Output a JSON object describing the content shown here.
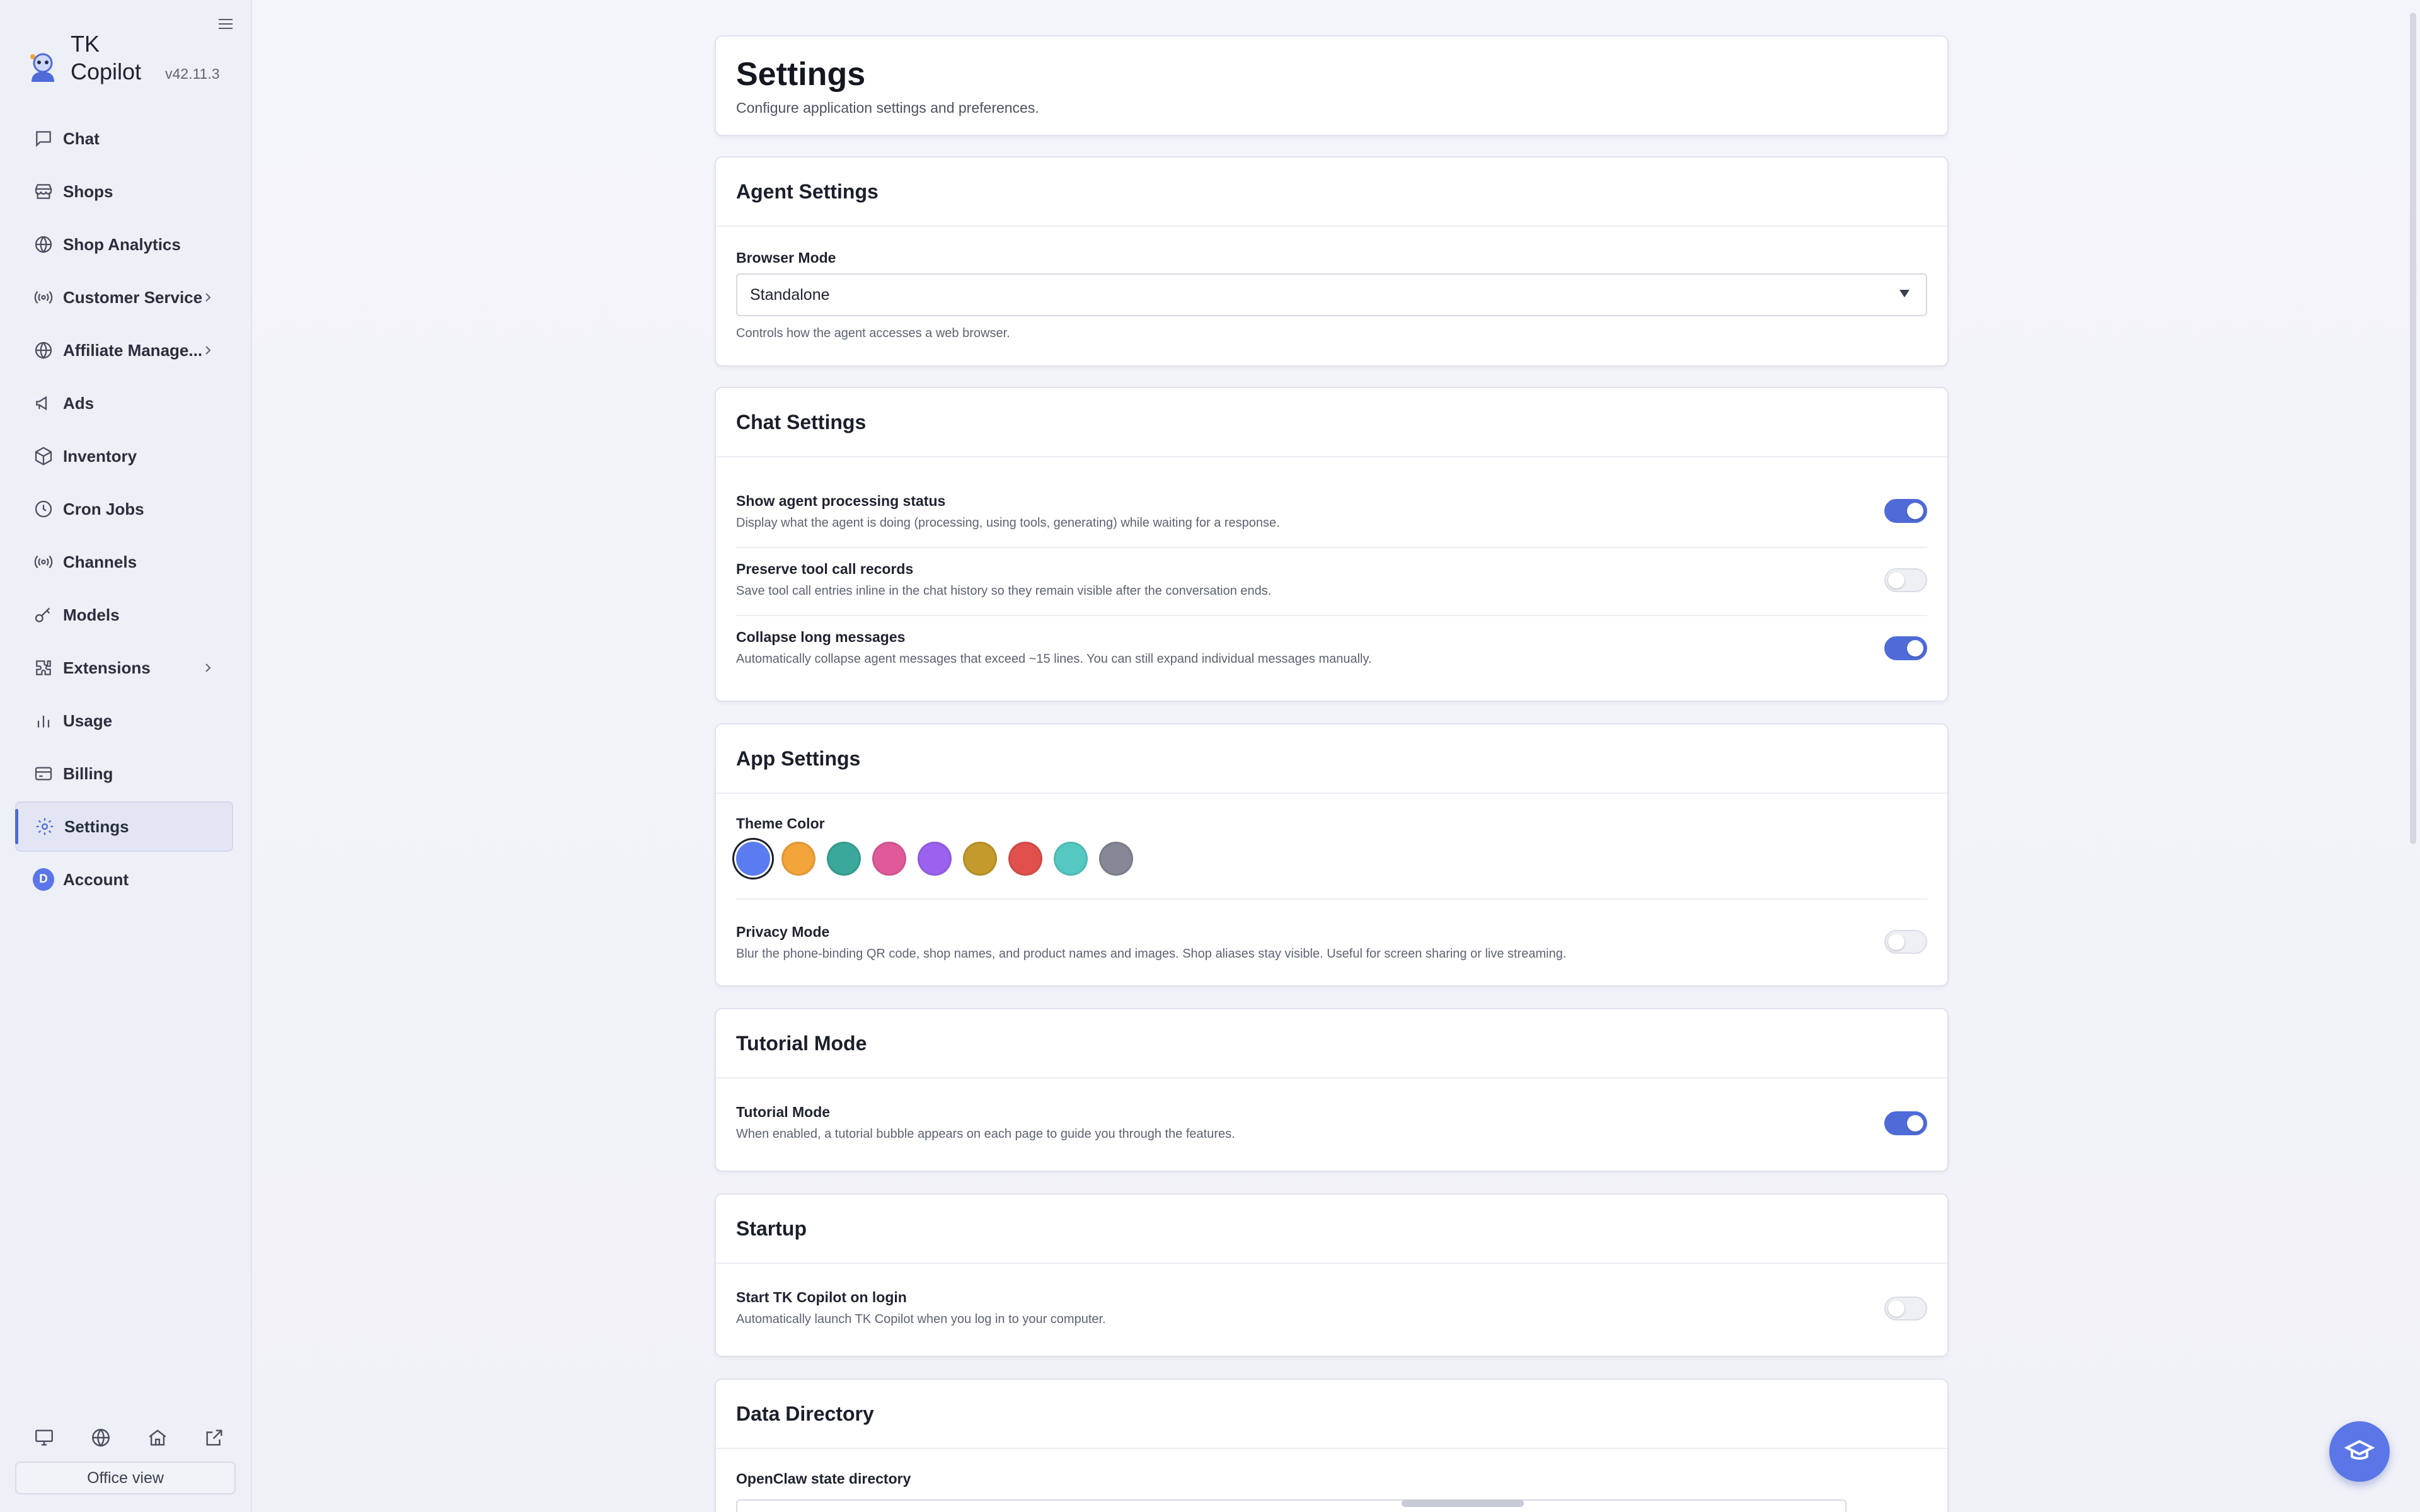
{
  "app": {
    "name": "TK Copilot",
    "version": "v42.11.3"
  },
  "sidebar": {
    "items": [
      {
        "label": "Chat",
        "icon": "chat-icon"
      },
      {
        "label": "Shops",
        "icon": "store-icon"
      },
      {
        "label": "Shop Analytics",
        "icon": "globe-icon"
      },
      {
        "label": "Customer Service",
        "icon": "broadcast-icon"
      },
      {
        "label": "Affiliate Manage...",
        "icon": "globe-icon"
      },
      {
        "label": "Ads",
        "icon": "megaphone-icon"
      },
      {
        "label": "Inventory",
        "icon": "box-icon"
      },
      {
        "label": "Cron Jobs",
        "icon": "clock-icon"
      },
      {
        "label": "Channels",
        "icon": "broadcast-icon"
      },
      {
        "label": "Models",
        "icon": "key-icon"
      },
      {
        "label": "Extensions",
        "icon": "puzzle-icon"
      },
      {
        "label": "Usage",
        "icon": "bar-chart-icon"
      },
      {
        "label": "Billing",
        "icon": "card-icon"
      },
      {
        "label": "Settings",
        "icon": "gear-icon"
      },
      {
        "label": "Account",
        "icon": "avatar-icon",
        "avatar_letter": "D"
      }
    ],
    "active": "Settings",
    "office_view": "Office view"
  },
  "page": {
    "title": "Settings",
    "subtitle": "Configure application settings and preferences."
  },
  "agent_settings": {
    "title": "Agent Settings",
    "browser_mode_label": "Browser Mode",
    "browser_mode_value": "Standalone",
    "browser_mode_hint": "Controls how the agent accesses a web browser."
  },
  "chat_settings": {
    "title": "Chat Settings",
    "rows": [
      {
        "title": "Show agent processing status",
        "desc": "Display what the agent is doing (processing, using tools, generating) while waiting for a response.",
        "on": true
      },
      {
        "title": "Preserve tool call records",
        "desc": "Save tool call entries inline in the chat history so they remain visible after the conversation ends.",
        "on": false
      },
      {
        "title": "Collapse long messages",
        "desc": "Automatically collapse agent messages that exceed ~15 lines. You can still expand individual messages manually.",
        "on": true
      }
    ]
  },
  "app_settings": {
    "title": "App Settings",
    "theme_label": "Theme Color",
    "theme_colors": [
      "#5b7cf0",
      "#f2a43a",
      "#3aa89a",
      "#e05a9a",
      "#9a62ee",
      "#c49a2c",
      "#e0504c",
      "#56c8c2",
      "#858895"
    ],
    "selected_theme": 0,
    "privacy_title": "Privacy Mode",
    "privacy_desc": "Blur the phone-binding QR code, shop names, and product names and images. Shop aliases stay visible. Useful for screen sharing or live streaming.",
    "privacy_on": false
  },
  "tutorial": {
    "title": "Tutorial Mode",
    "row_title": "Tutorial Mode",
    "row_desc": "When enabled, a tutorial bubble appears on each page to guide you through the features.",
    "on": true
  },
  "startup": {
    "title": "Startup",
    "row_title": "Start TK Copilot on login",
    "row_desc": "Automatically launch TK Copilot when you log in to your computer.",
    "on": false
  },
  "data_directory": {
    "title": "Data Directory",
    "label": "OpenClaw state directory"
  },
  "colors": {
    "accent": "#4f6bd8"
  }
}
